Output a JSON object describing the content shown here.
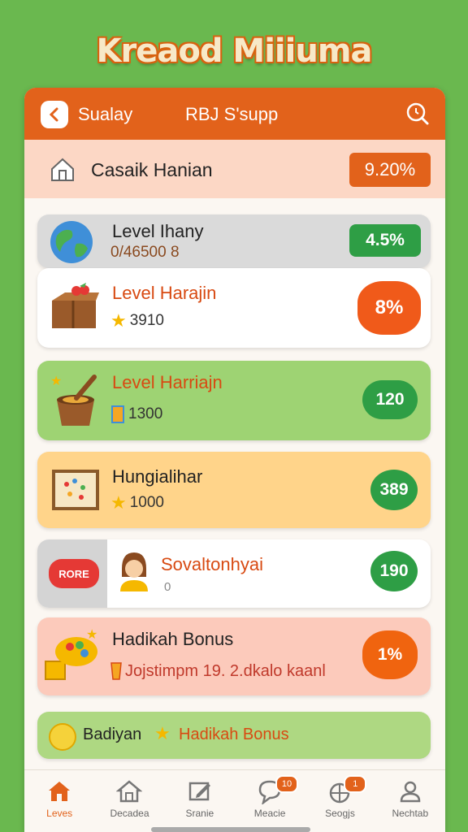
{
  "app_title": "Kreaod Miiiuma",
  "topbar": {
    "back_label": "Sualay",
    "center_label": "RBJ S'supp"
  },
  "daily": {
    "title": "Casaik Hanian",
    "percent": "9.20%"
  },
  "cards": [
    {
      "name": "Level Ihany",
      "sub": "0/46500 8",
      "badge": "4.5%",
      "color": "#dadada",
      "badge_color": "#2e9e45"
    },
    {
      "name": "Level Harajin",
      "sub": "3910",
      "badge": "8%",
      "color": "#ffffff",
      "badge_color": "#f05a1a"
    },
    {
      "name": "Level Harriajn",
      "sub": "1300",
      "badge": "120",
      "color": "#9ed373",
      "badge_color": "#2e9e45"
    },
    {
      "name": "Hungialihar",
      "sub": "1000",
      "badge": "389",
      "color": "#ffd48a",
      "badge_color": "#2e9e45"
    },
    {
      "name": "Sovaltonhyai",
      "sub": "0",
      "badge": "190",
      "color": "#ffffff",
      "badge_color": "#2e9e45",
      "tag": "RORE"
    },
    {
      "name": "Hadikah Bonus",
      "sub": "Jojstimpm 19. 2.dkalo kaanl",
      "badge": "1%",
      "color": "#fccabb",
      "badge_color": "#f0640f"
    }
  ],
  "bonus_bar": {
    "label": "Badiyan",
    "highlight": "Hadikah Bonus"
  },
  "tabs": [
    {
      "label": "Leves",
      "icon": "home-icon",
      "active": true
    },
    {
      "label": "Decadea",
      "icon": "house-icon"
    },
    {
      "label": "Sranie",
      "icon": "edit-icon"
    },
    {
      "label": "Meacie",
      "icon": "chat-icon",
      "badge": "10"
    },
    {
      "label": "Seogjs",
      "icon": "gift-icon",
      "badge": "1"
    },
    {
      "label": "Nechtab",
      "icon": "profile-icon"
    }
  ]
}
